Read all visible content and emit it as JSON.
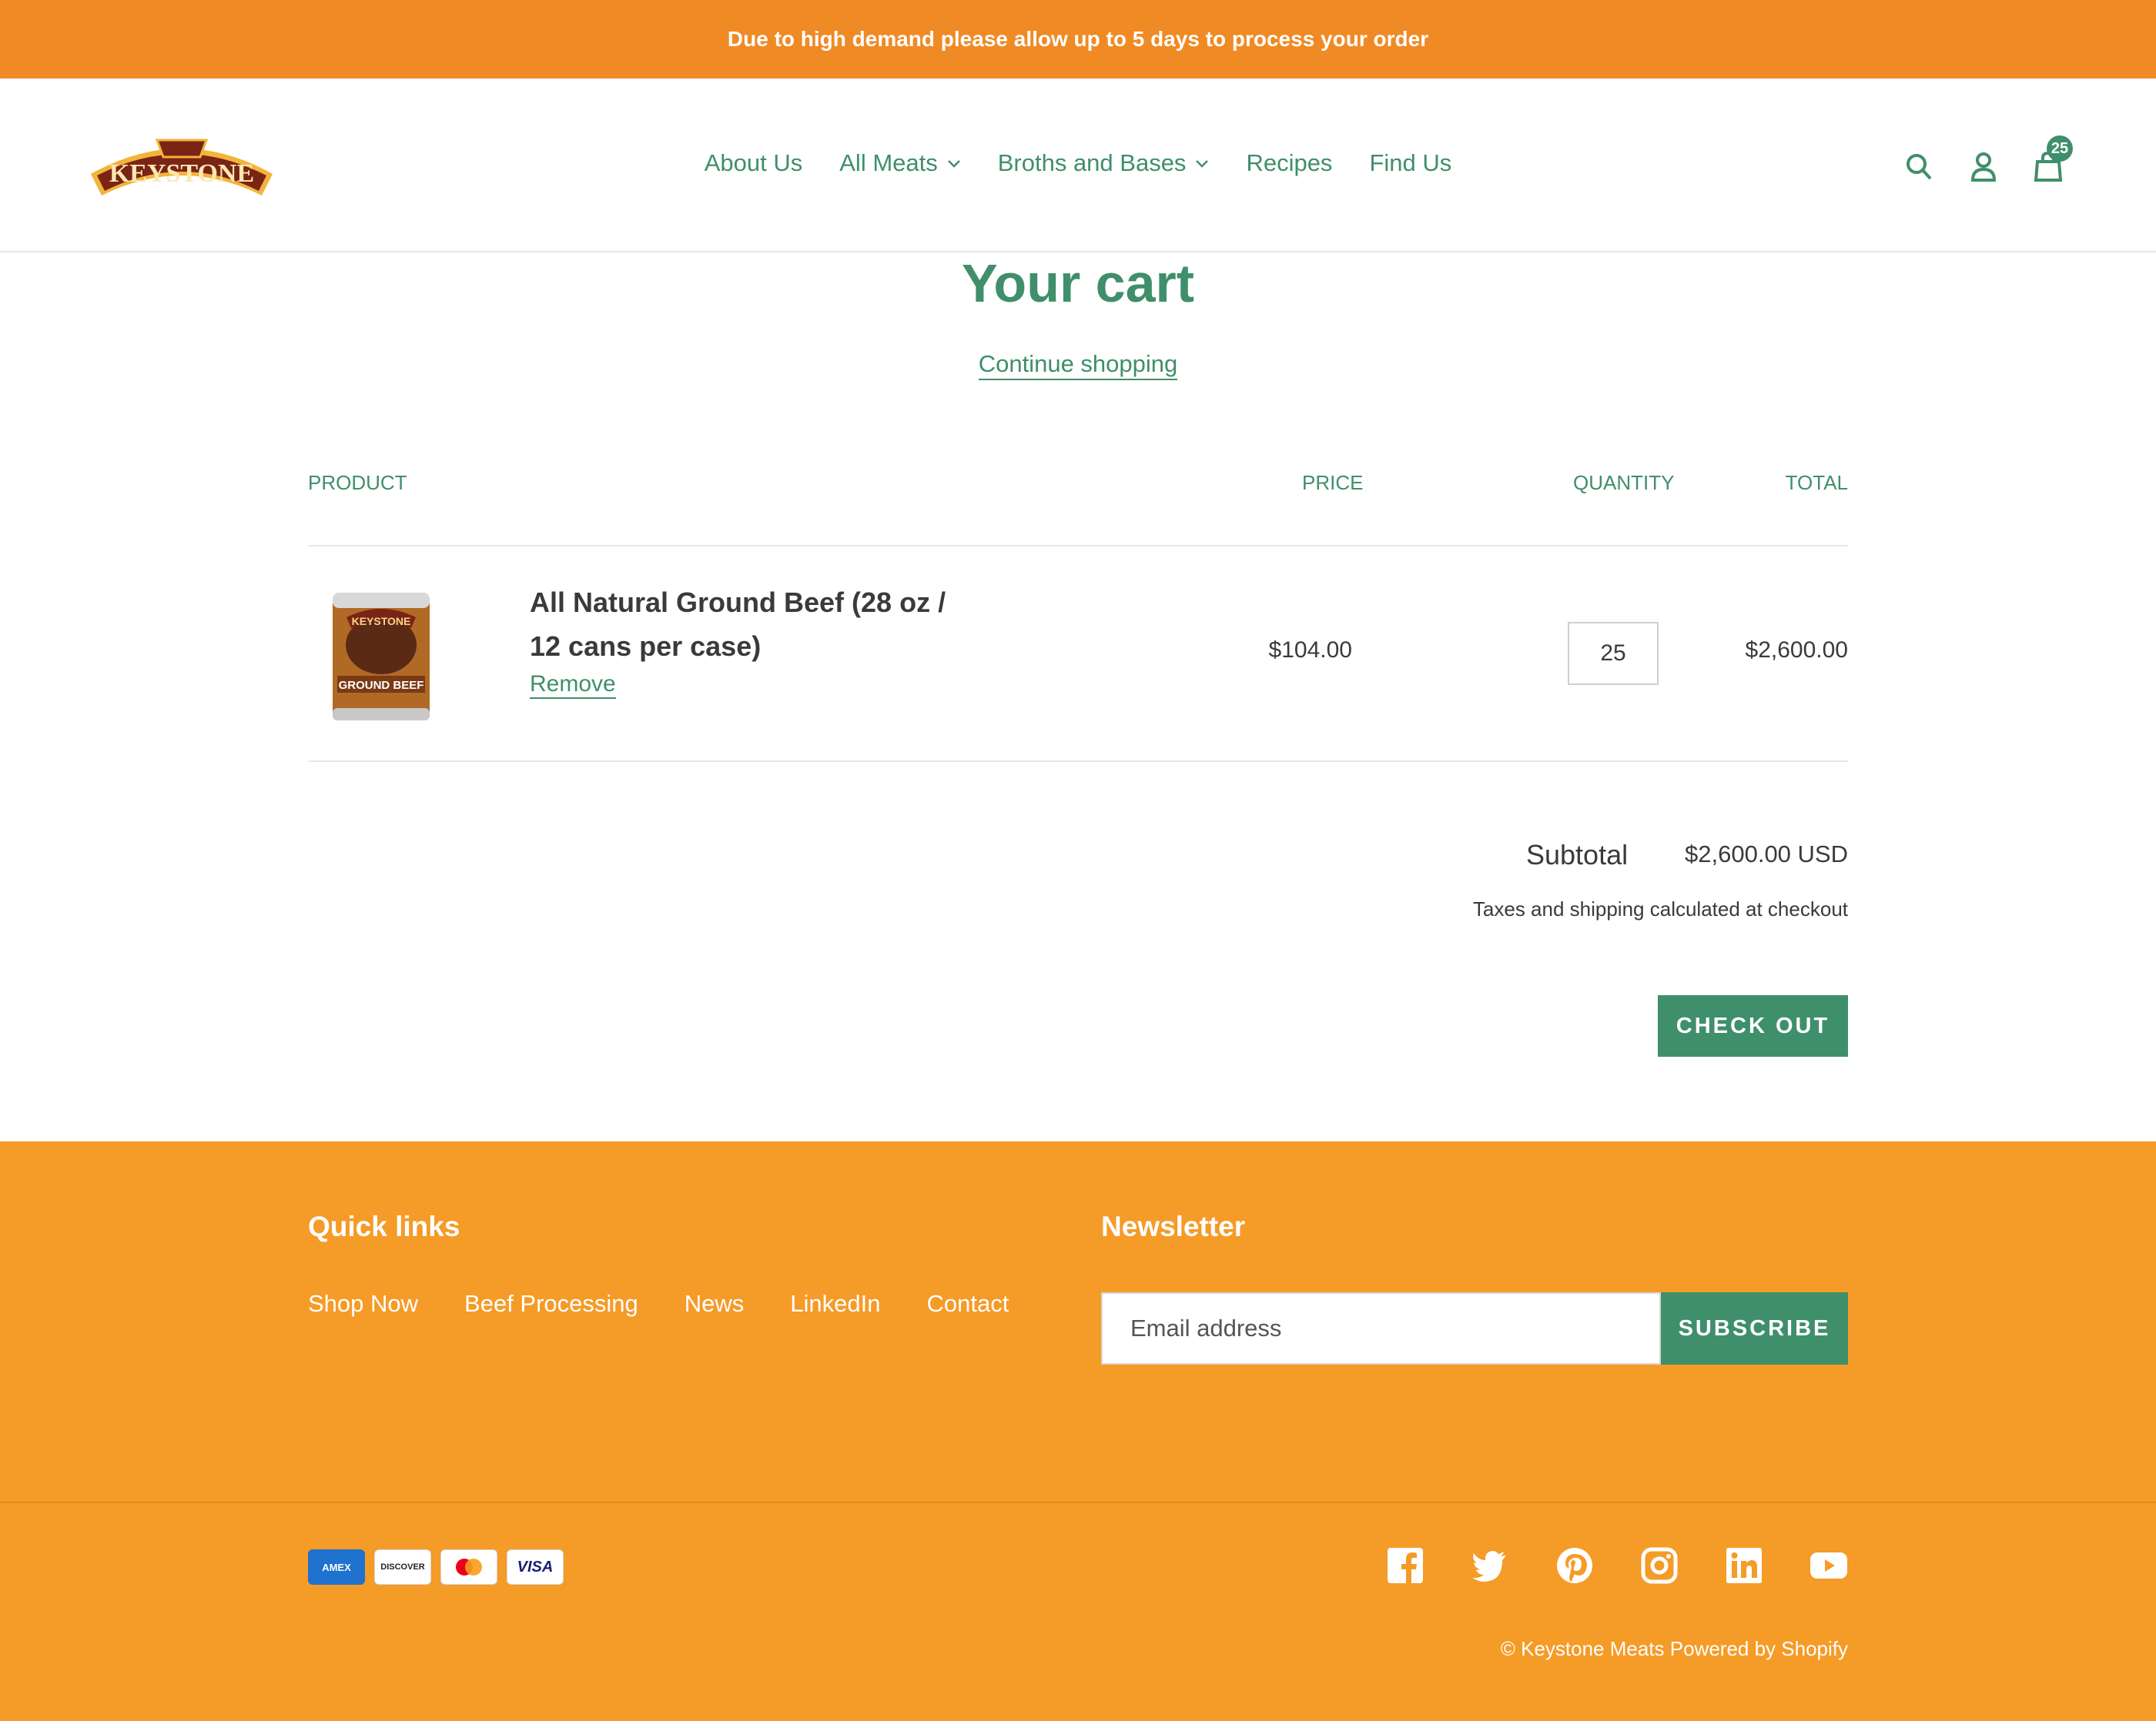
{
  "announcement": "Due to high demand please allow up to 5 days to process your order",
  "brand": {
    "logo_text": "KEYSTONE"
  },
  "nav": {
    "items": [
      {
        "label": "About Us",
        "has_dropdown": false
      },
      {
        "label": "All Meats",
        "has_dropdown": true
      },
      {
        "label": "Broths and Bases",
        "has_dropdown": true
      },
      {
        "label": "Recipes",
        "has_dropdown": false
      },
      {
        "label": "Find Us",
        "has_dropdown": false
      }
    ]
  },
  "header_icons": {
    "search": "search-icon",
    "account": "account-icon",
    "cart": "cart-icon",
    "cart_count": "25"
  },
  "cart": {
    "title": "Your cart",
    "continue_label": "Continue shopping",
    "columns": {
      "product": "PRODUCT",
      "price": "PRICE",
      "quantity": "QUANTITY",
      "total": "TOTAL"
    },
    "items": [
      {
        "name": "All Natural Ground Beef (28 oz / 12 cans per case)",
        "image_label": "GROUND BEEF",
        "remove_label": "Remove",
        "price": "$104.00",
        "quantity": "25",
        "total": "$2,600.00"
      }
    ],
    "subtotal_label": "Subtotal",
    "subtotal_value": "$2,600.00 USD",
    "tax_note": "Taxes and shipping calculated at checkout",
    "checkout_label": "CHECK OUT"
  },
  "footer": {
    "quick_links_title": "Quick links",
    "quick_links": [
      "Shop Now",
      "Beef Processing",
      "News",
      "LinkedIn",
      "Contact"
    ],
    "newsletter_title": "Newsletter",
    "email_placeholder": "Email address",
    "subscribe_label": "SUBSCRIBE",
    "payment_methods": [
      "AMEX",
      "DISCOVER",
      "",
      "VISA"
    ],
    "social": [
      "facebook-icon",
      "twitter-icon",
      "pinterest-icon",
      "instagram-icon",
      "linkedin-icon",
      "youtube-icon"
    ],
    "copyright": "© Keystone Meats Powered by Shopify"
  },
  "colors": {
    "accent": "#3f8f6a",
    "announcement_bg": "#f08a24",
    "footer_bg": "#f59b27"
  }
}
